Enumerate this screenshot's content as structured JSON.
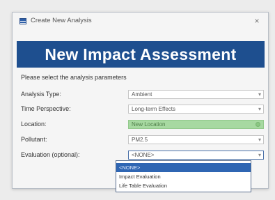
{
  "window": {
    "title": "Create New Analysis",
    "close_glyph": "×",
    "icon": "window-app-icon"
  },
  "banner": {
    "title": "New Impact Assessment"
  },
  "instructions": "Please select the analysis parameters",
  "fields": [
    {
      "label": "Analysis Type:",
      "value": "Ambient",
      "arrow": "▾"
    },
    {
      "label": "Time Perspective:",
      "value": "Long-term Effects",
      "arrow": "▾"
    },
    {
      "label": "Location:",
      "value": "New Location",
      "status": "valid"
    },
    {
      "label": "Pollutant:",
      "value": "PM2.5",
      "arrow": "▾"
    },
    {
      "label": "Evaluation (optional):",
      "value": "<NONE>",
      "arrow": "▾"
    }
  ],
  "evaluation_dropdown": {
    "options": [
      "<NONE>",
      "Impact Evaluation",
      "Life Table Evaluation"
    ],
    "selected_index": 0
  },
  "colors": {
    "banner": "#1e4f8f",
    "location_valid": "#a7d9a1",
    "selection": "#2f66b3"
  }
}
